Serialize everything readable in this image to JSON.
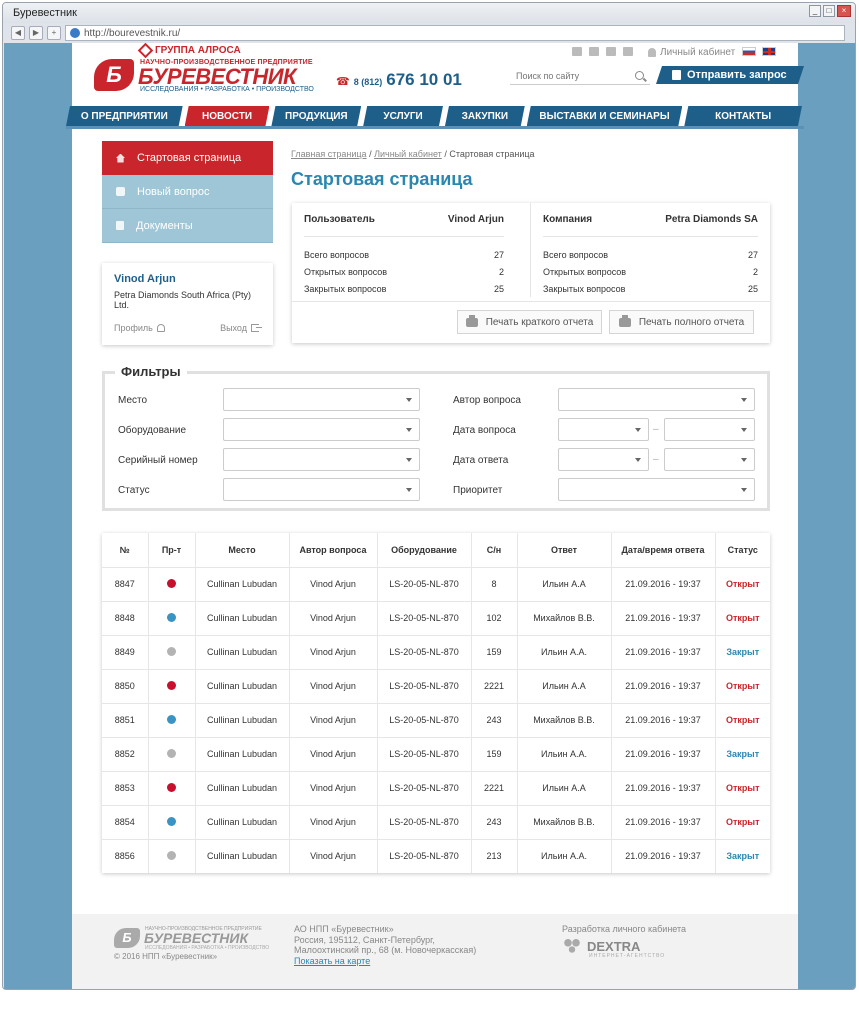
{
  "window": {
    "title": "Буревестник",
    "url": "http://bourevestnik.ru/"
  },
  "header": {
    "group": "ГРУППА АЛРОСА",
    "logo_letter": "Б",
    "logo_sub1": "НАУЧНО-ПРОИЗВОДСТВЕННОЕ ПРЕДПРИЯТИЕ",
    "logo_name": "БУРЕВЕСТНИК",
    "logo_sub2": "ИССЛЕДОВАНИЯ • РАЗРАБОТКА • ПРОИЗВОДСТВО",
    "phone_code": "8 (812)",
    "phone_number": "676 10 01",
    "cabinet": "Личный кабинет",
    "search_placeholder": "Поиск по сайту",
    "send_request": "Отправить запрос"
  },
  "nav": [
    {
      "label": "О ПРЕДПРИЯТИИ",
      "active": false
    },
    {
      "label": "НОВОСТИ",
      "active": true
    },
    {
      "label": "ПРОДУКЦИЯ",
      "active": false
    },
    {
      "label": "УСЛУГИ",
      "active": false
    },
    {
      "label": "ЗАКУПКИ",
      "active": false
    },
    {
      "label": "ВЫСТАВКИ И СЕМИНАРЫ",
      "active": false
    },
    {
      "label": "КОНТАКТЫ",
      "active": false
    }
  ],
  "side_menu": [
    {
      "label": "Стартовая страница",
      "icon": "home-icon",
      "active": true
    },
    {
      "label": "Новый вопрос",
      "icon": "question-icon",
      "active": false
    },
    {
      "label": "Документы",
      "icon": "document-icon",
      "active": false
    }
  ],
  "user_card": {
    "name": "Vinod Arjun",
    "company": "Petra Diamonds South Africa (Pty) Ltd.",
    "profile": "Профиль",
    "logout": "Выход"
  },
  "breadcrumb": {
    "home": "Главная страница",
    "cabinet": "Личный кабинет",
    "current": "Стартовая страница"
  },
  "page_title": "Стартовая страница",
  "stats": {
    "user_label": "Пользователь",
    "user_value": "Vinod Arjun",
    "company_label": "Компания",
    "company_value": "Petra Diamonds SA",
    "rows_user": [
      {
        "label": "Всего вопросов",
        "value": "27"
      },
      {
        "label": "Открытых вопросов",
        "value": "2"
      },
      {
        "label": "Закрытых вопросов",
        "value": "25"
      }
    ],
    "rows_company": [
      {
        "label": "Всего вопросов",
        "value": "27"
      },
      {
        "label": "Открытых вопросов",
        "value": "2"
      },
      {
        "label": "Закрытых вопросов",
        "value": "25"
      }
    ],
    "print_short": "Печать краткого отчета",
    "print_full": "Печать полного отчета"
  },
  "filters": {
    "title": "Фильтры",
    "place": "Место",
    "equipment": "Оборудование",
    "serial": "Серийный номер",
    "status": "Статус",
    "author": "Автор вопроса",
    "question_date": "Дата вопроса",
    "answer_date": "Дата ответа",
    "priority": "Приоритет",
    "dash": "–"
  },
  "table": {
    "headers": [
      "№",
      "Пр-т",
      "Место",
      "Автор вопроса",
      "Оборудование",
      "С/н",
      "Ответ",
      "Дата/время ответа",
      "Статус"
    ],
    "colors": {
      "high": "#c8102e",
      "mid": "#3a93c2",
      "low": "#b3b3b3",
      "open": "#c8262c",
      "closed": "#2b87b0"
    },
    "rows": [
      {
        "num": "8847",
        "priority": "high",
        "place": "Cullinan Lubudan",
        "author": "Vinod Arjun",
        "equipment": "LS-20-05-NL-870",
        "sn": "8",
        "answer": "Ильин А.А",
        "datetime": "21.09.2016 - 19:37",
        "status": "Открыт",
        "status_type": "open"
      },
      {
        "num": "8848",
        "priority": "mid",
        "place": "Cullinan Lubudan",
        "author": "Vinod Arjun",
        "equipment": "LS-20-05-NL-870",
        "sn": "102",
        "answer": "Михайлов В.В.",
        "datetime": "21.09.2016 - 19:37",
        "status": "Открыт",
        "status_type": "open"
      },
      {
        "num": "8849",
        "priority": "low",
        "place": "Cullinan Lubudan",
        "author": "Vinod Arjun",
        "equipment": "LS-20-05-NL-870",
        "sn": "159",
        "answer": "Ильин А.А.",
        "datetime": "21.09.2016 - 19:37",
        "status": "Закрыт",
        "status_type": "closed"
      },
      {
        "num": "8850",
        "priority": "high",
        "place": "Cullinan Lubudan",
        "author": "Vinod Arjun",
        "equipment": "LS-20-05-NL-870",
        "sn": "2221",
        "answer": "Ильин А.А",
        "datetime": "21.09.2016 - 19:37",
        "status": "Открыт",
        "status_type": "open"
      },
      {
        "num": "8851",
        "priority": "mid",
        "place": "Cullinan Lubudan",
        "author": "Vinod Arjun",
        "equipment": "LS-20-05-NL-870",
        "sn": "243",
        "answer": "Михайлов В.В.",
        "datetime": "21.09.2016 - 19:37",
        "status": "Открыт",
        "status_type": "open"
      },
      {
        "num": "8852",
        "priority": "low",
        "place": "Cullinan Lubudan",
        "author": "Vinod Arjun",
        "equipment": "LS-20-05-NL-870",
        "sn": "159",
        "answer": "Ильин А.А.",
        "datetime": "21.09.2016 - 19:37",
        "status": "Закрыт",
        "status_type": "closed"
      },
      {
        "num": "8853",
        "priority": "high",
        "place": "Cullinan Lubudan",
        "author": "Vinod Arjun",
        "equipment": "LS-20-05-NL-870",
        "sn": "2221",
        "answer": "Ильин А.А",
        "datetime": "21.09.2016 - 19:37",
        "status": "Открыт",
        "status_type": "open"
      },
      {
        "num": "8854",
        "priority": "mid",
        "place": "Cullinan Lubudan",
        "author": "Vinod Arjun",
        "equipment": "LS-20-05-NL-870",
        "sn": "243",
        "answer": "Михайлов В.В.",
        "datetime": "21.09.2016 - 19:37",
        "status": "Открыт",
        "status_type": "open"
      },
      {
        "num": "8856",
        "priority": "low",
        "place": "Cullinan Lubudan",
        "author": "Vinod Arjun",
        "equipment": "LS-20-05-NL-870",
        "sn": "213",
        "answer": "Ильин А.А.",
        "datetime": "21.09.2016 - 19:37",
        "status": "Закрыт",
        "status_type": "closed"
      }
    ]
  },
  "footer": {
    "copyright": "© 2016 НПП «Буревестник»",
    "addr1": "АО НПП «Буревестник»",
    "addr2": "Россия, 195112, Санкт-Петербург,",
    "addr3": "Малоохтинский пр., 68 (м. Новочеркасская)",
    "map_link": "Показать на карте",
    "dev_label": "Разработка личного кабинета",
    "dev_name": "DEXTRA",
    "dev_sub": "ИНТЕРНЕТ-АГЕНТСТВО"
  }
}
